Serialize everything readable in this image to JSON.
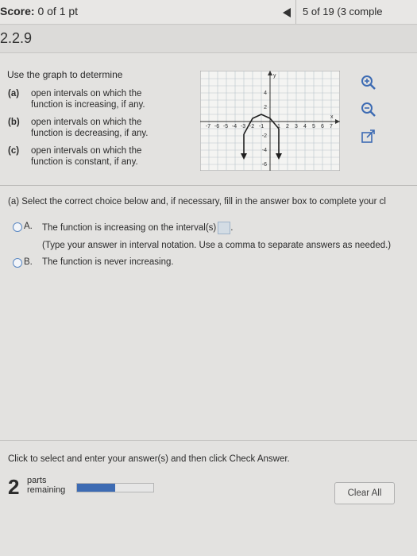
{
  "header": {
    "score_label": "Score:",
    "score_value": "0 of 1 pt",
    "progress": "5 of 19 (3 comple"
  },
  "question": {
    "number": "2.2.9",
    "intro": "Use the graph to determine",
    "parts": [
      {
        "label": "(a)",
        "lines": [
          "open intervals on which the",
          "function is increasing, if any."
        ]
      },
      {
        "label": "(b)",
        "lines": [
          "open intervals on which the",
          "function is decreasing, if any."
        ]
      },
      {
        "label": "(c)",
        "lines": [
          "open intervals on which the",
          "function is constant, if any."
        ]
      }
    ]
  },
  "graph": {
    "axis_x": "x",
    "axis_y": "y",
    "x_ticks": [
      "-7",
      "-6",
      "-5",
      "-4",
      "-3",
      "-2",
      "-1",
      "1",
      "2",
      "3",
      "4",
      "5",
      "6",
      "7"
    ],
    "y_ticks": [
      "4",
      "2",
      "-2",
      "-4",
      "-6"
    ]
  },
  "icons": [
    "zoom-in-icon",
    "zoom-out-icon",
    "external-link-icon"
  ],
  "answer": {
    "instruction": "(a) Select the correct choice below and, if necessary, fill in the answer box to complete your cl",
    "choice_a_letter": "A.",
    "choice_a_text": "The function is increasing on the interval(s)",
    "choice_a_suffix": ".",
    "choice_a_hint": "(Type your answer in interval notation. Use a comma to separate answers as needed.)",
    "choice_b_letter": "B.",
    "choice_b_text": "The function is never increasing."
  },
  "footer": {
    "instruction": "Click to select and enter your answer(s) and then click Check Answer.",
    "parts_count": "2",
    "parts_label_1": "parts",
    "parts_label_2": "remaining",
    "progress_fraction": 0.5,
    "clear_label": "Clear All"
  },
  "colors": {
    "accent": "#3d6bb3",
    "radio_border": "#5a87c2"
  }
}
